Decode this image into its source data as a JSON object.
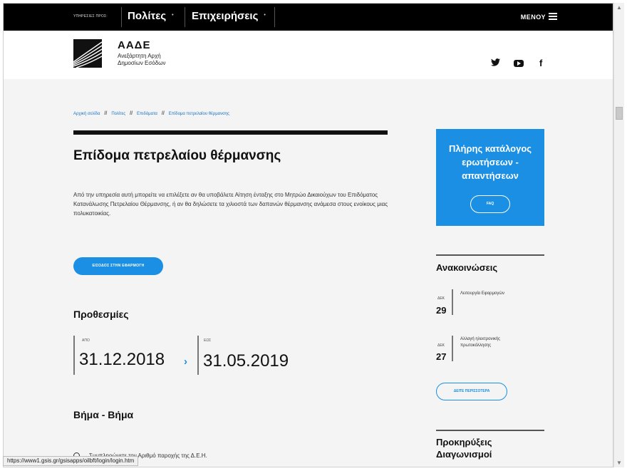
{
  "topbar": {
    "services_label": "ΥΠΗΡΕΣΙΕΣ ΠΡΟΣ:",
    "nav": [
      {
        "label": "Πολίτες",
        "dot": "•"
      },
      {
        "label": "Επιχειρήσεις",
        "dot": "•"
      }
    ],
    "menu_label": "ΜΕΝΟΥ"
  },
  "header": {
    "brand_title": "ΑΑΔΕ",
    "brand_subtitle_line1": "Ανεξάρτητη Αρχή",
    "brand_subtitle_line2": "Δημοσίων Εσόδων",
    "social": {
      "twitter": "🐦",
      "facebook": "f"
    }
  },
  "breadcrumb": {
    "items": [
      "Αρχική σελίδα",
      "Πολίτες",
      "Επιδόματα",
      "Επίδομα πετρελαίου θέρμανσης"
    ],
    "separator": "//"
  },
  "main": {
    "title": "Επίδομα πετρελαίου θέρμανσης",
    "intro": "Από την υπηρεσία αυτή μπορείτε να επιλέξετε αν θα υποβάλετε Αίτηση ένταξης στο Μητρώο Δικαιούχων του Επιδόματος Κατανάλωσης Πετρελαίου Θέρμανσης, ή αν θα δηλώσετε τα χιλιοστά των δαπανών θέρμανσης ανάμεσα στους ενοίκους μιας πολυκατοικίας.",
    "app_button": "ΕΙΣΟΔΟΣ ΣΤΗΝ ΕΦΑΡΜΟΓΗ",
    "deadlines_title": "Προθεσμίες",
    "from_label": "ΑΠΟ",
    "from_date": "31.12.2018",
    "to_label": "ΕΩΣ",
    "to_date": "31.05.2019",
    "arrow": "›",
    "steps_title": "Βήμα - Βήμα",
    "step1": "Συμπληρώνετε τον Αριθμό παροχής της Δ.Ε.Η."
  },
  "sidebar": {
    "faq_title_line1": "Πλήρης κατάλογος",
    "faq_title_line2": "ερωτήσεων -",
    "faq_title_line3": "απαντήσεων",
    "faq_button": "FAQ",
    "announcements_title": "Ανακοινώσεις",
    "announcements": [
      {
        "month": "ΔΕΚ",
        "day": "29",
        "text": "Λειτουργία Εφαρμογών"
      },
      {
        "month": "ΔΕΚ",
        "day": "27",
        "text": "Αλλαγή ηλεκτρονικής πρωτοκόλλησης"
      }
    ],
    "more_button": "ΔΕΙΤΕ ΠΕΡΙΣΣΟΤΕΡΑ",
    "tenders_line1": "Προκηρύξεις",
    "tenders_line2": "Διαγωνισμοί"
  },
  "status_bar": {
    "url": "https://www1.gsis.gr/gsisapps/oilbft/login/login.htm"
  },
  "colors": {
    "accent": "#1a8fe3",
    "topbar": "#000000",
    "background": "#f4f4f4"
  }
}
